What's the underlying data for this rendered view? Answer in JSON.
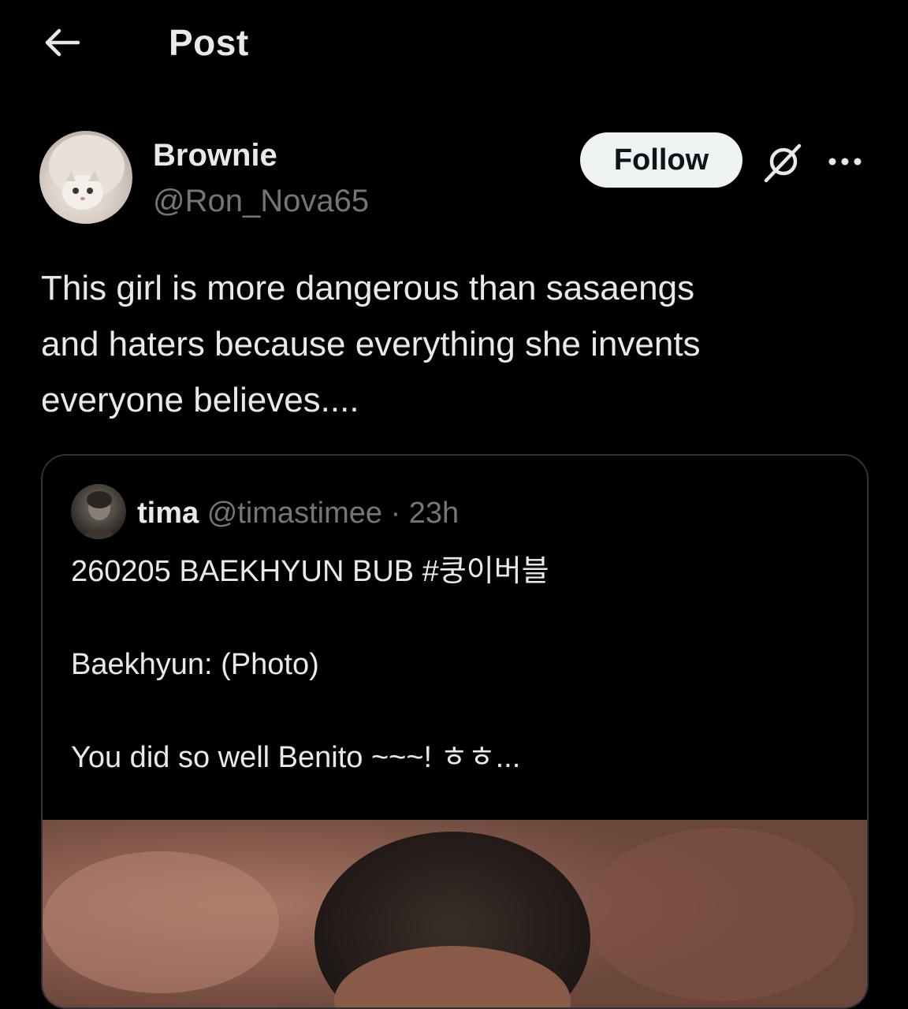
{
  "header": {
    "title": "Post",
    "back_icon": "arrow-left-icon"
  },
  "post": {
    "author": {
      "display_name": "Brownie",
      "handle": "@Ron_Nova65"
    },
    "follow_label": "Follow",
    "grok_icon": "grok-icon",
    "more_icon": "more-horizontal-icon",
    "text": "This girl is more dangerous than sasaengs\nand haters because everything she invents\neveryone believes...."
  },
  "quoted_post": {
    "display_name": "tima",
    "handle": "@timastimee",
    "separator": "·",
    "time": "23h",
    "text": "260205 BAEKHYUN BUB #쿵이버블\n\nBaekhyun: (Photo)\n\nYou did so well Benito ~~~! ㅎㅎ..."
  },
  "colors": {
    "background": "#000000",
    "primary_text": "#e7e9ea",
    "secondary_text": "#71767b",
    "border": "#2f3336",
    "follow_bg": "#eff3f4"
  }
}
